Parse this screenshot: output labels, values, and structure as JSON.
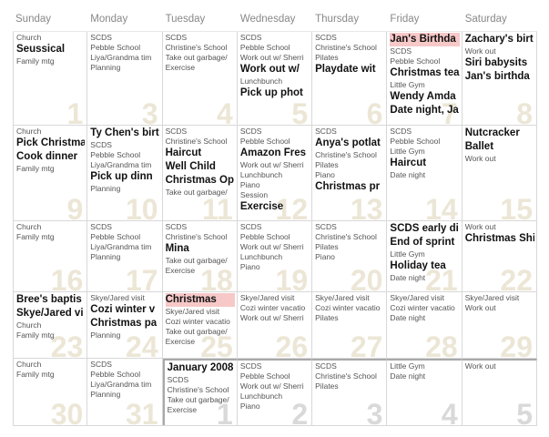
{
  "days_of_week": [
    "Sunday",
    "Monday",
    "Tuesday",
    "Wednesday",
    "Thursday",
    "Friday",
    "Saturday"
  ],
  "weeks": [
    {
      "h": 102,
      "cells": [
        {
          "day": "1",
          "events": [
            {
              "t": "Church",
              "s": "s"
            },
            {
              "t": "Seussical",
              "s": "b"
            },
            {
              "t": "Family mtg",
              "s": "s"
            }
          ]
        },
        {
          "day": "3",
          "events": [
            {
              "t": "SCDS",
              "s": "s"
            },
            {
              "t": "Pebble School",
              "s": "s"
            },
            {
              "t": "Liya/Grandma tim",
              "s": "s"
            },
            {
              "t": "Planning",
              "s": "s"
            }
          ]
        },
        {
          "day": "4",
          "events": [
            {
              "t": "SCDS",
              "s": "s"
            },
            {
              "t": "Christine's School",
              "s": "s"
            },
            {
              "t": "Take out garbage/",
              "s": "s"
            },
            {
              "t": "Exercise",
              "s": "s"
            }
          ]
        },
        {
          "day": "5",
          "events": [
            {
              "t": "SCDS",
              "s": "s"
            },
            {
              "t": "Pebble School",
              "s": "s"
            },
            {
              "t": "Work out w/ Sherri",
              "s": "s"
            },
            {
              "t": "Work out w/",
              "s": "b"
            },
            {
              "t": "Lunchbunch",
              "s": "s"
            },
            {
              "t": "Pick up phot",
              "s": "b"
            }
          ]
        },
        {
          "day": "6",
          "events": [
            {
              "t": "SCDS",
              "s": "s"
            },
            {
              "t": "Christine's School",
              "s": "s"
            },
            {
              "t": "Pilates",
              "s": "s"
            },
            {
              "t": "Playdate wit",
              "s": "b"
            }
          ]
        },
        {
          "day": "7",
          "events": [
            {
              "t": "Jan's Birthda",
              "s": "b",
              "hl": true
            },
            {
              "t": "SCDS",
              "s": "s"
            },
            {
              "t": "Pebble School",
              "s": "s"
            },
            {
              "t": "Christmas tea",
              "s": "b"
            },
            {
              "t": "Little Gym",
              "s": "s"
            },
            {
              "t": "Wendy Amda",
              "s": "b"
            },
            {
              "t": "Date night, Ja",
              "s": "b"
            }
          ]
        },
        {
          "day": "8",
          "events": [
            {
              "t": "Zachary's birt",
              "s": "b"
            },
            {
              "t": "Work out",
              "s": "s"
            },
            {
              "t": "Siri babysits",
              "s": "b"
            },
            {
              "t": "Jan's birthda",
              "s": "b"
            }
          ]
        }
      ]
    },
    {
      "h": 104,
      "cells": [
        {
          "day": "9",
          "events": [
            {
              "t": "Church",
              "s": "s"
            },
            {
              "t": "Pick Christma",
              "s": "b"
            },
            {
              "t": "Cook dinner",
              "s": "b"
            },
            {
              "t": "Family mtg",
              "s": "s"
            }
          ]
        },
        {
          "day": "10",
          "events": [
            {
              "t": "Ty Chen's birt",
              "s": "b"
            },
            {
              "t": "SCDS",
              "s": "s"
            },
            {
              "t": "Pebble School",
              "s": "s"
            },
            {
              "t": "Liya/Grandma tim",
              "s": "s"
            },
            {
              "t": "Pick up dinn",
              "s": "b"
            },
            {
              "t": "Planning",
              "s": "s"
            }
          ]
        },
        {
          "day": "11",
          "events": [
            {
              "t": "SCDS",
              "s": "s"
            },
            {
              "t": "Christine's School",
              "s": "s"
            },
            {
              "t": "Haircut",
              "s": "b"
            },
            {
              "t": "Well Child",
              "s": "b"
            },
            {
              "t": "Christmas Op",
              "s": "b"
            },
            {
              "t": "Take out garbage/",
              "s": "s"
            }
          ]
        },
        {
          "day": "12",
          "events": [
            {
              "t": "SCDS",
              "s": "s"
            },
            {
              "t": "Pebble School",
              "s": "s"
            },
            {
              "t": "Amazon Fres",
              "s": "b"
            },
            {
              "t": "Work out w/ Sherri",
              "s": "s"
            },
            {
              "t": "Lunchbunch",
              "s": "s"
            },
            {
              "t": "Piano",
              "s": "s"
            },
            {
              "t": "Session",
              "s": "s"
            },
            {
              "t": "Exercise",
              "s": "b"
            }
          ]
        },
        {
          "day": "13",
          "events": [
            {
              "t": "SCDS",
              "s": "s"
            },
            {
              "t": "Anya's potlat",
              "s": "b"
            },
            {
              "t": "Christine's School",
              "s": "s"
            },
            {
              "t": "Pilates",
              "s": "s"
            },
            {
              "t": "Piano",
              "s": "s"
            },
            {
              "t": "Christmas pr",
              "s": "b"
            }
          ]
        },
        {
          "day": "14",
          "events": [
            {
              "t": "SCDS",
              "s": "s"
            },
            {
              "t": "Pebble School",
              "s": "s"
            },
            {
              "t": "Little Gym",
              "s": "s"
            },
            {
              "t": "Haircut",
              "s": "b"
            },
            {
              "t": "Date night",
              "s": "s"
            }
          ]
        },
        {
          "day": "15",
          "events": [
            {
              "t": "Nutcracker",
              "s": "b"
            },
            {
              "t": "Ballet",
              "s": "b"
            },
            {
              "t": "Work out",
              "s": "s"
            }
          ]
        }
      ]
    },
    {
      "h": 77,
      "cells": [
        {
          "day": "16",
          "events": [
            {
              "t": "Church",
              "s": "s"
            },
            {
              "t": "Family mtg",
              "s": "s"
            }
          ]
        },
        {
          "day": "17",
          "events": [
            {
              "t": "SCDS",
              "s": "s"
            },
            {
              "t": "Pebble School",
              "s": "s"
            },
            {
              "t": "Liya/Grandma tim",
              "s": "s"
            },
            {
              "t": "Planning",
              "s": "s"
            }
          ]
        },
        {
          "day": "18",
          "events": [
            {
              "t": "SCDS",
              "s": "s"
            },
            {
              "t": "Christine's School",
              "s": "s"
            },
            {
              "t": "Mina",
              "s": "b"
            },
            {
              "t": "Take out garbage/",
              "s": "s"
            },
            {
              "t": "Exercise",
              "s": "s"
            }
          ]
        },
        {
          "day": "19",
          "events": [
            {
              "t": "SCDS",
              "s": "s"
            },
            {
              "t": "Pebble School",
              "s": "s"
            },
            {
              "t": "Work out w/ Sherri",
              "s": "s"
            },
            {
              "t": "Lunchbunch",
              "s": "s"
            },
            {
              "t": "Piano",
              "s": "s"
            }
          ]
        },
        {
          "day": "20",
          "events": [
            {
              "t": "SCDS",
              "s": "s"
            },
            {
              "t": "Christine's School",
              "s": "s"
            },
            {
              "t": "Pilates",
              "s": "s"
            },
            {
              "t": "Piano",
              "s": "s"
            }
          ]
        },
        {
          "day": "21",
          "events": [
            {
              "t": "SCDS early di",
              "s": "b"
            },
            {
              "t": "End of sprint",
              "s": "b"
            },
            {
              "t": "Little Gym",
              "s": "s"
            },
            {
              "t": "Holiday tea",
              "s": "b"
            },
            {
              "t": "Date night",
              "s": "s"
            }
          ]
        },
        {
          "day": "22",
          "events": [
            {
              "t": "Work out",
              "s": "s"
            },
            {
              "t": "Christmas Shi",
              "s": "b"
            }
          ]
        }
      ]
    },
    {
      "h": 72,
      "cells": [
        {
          "day": "23",
          "events": [
            {
              "t": "Bree's baptis",
              "s": "b"
            },
            {
              "t": "Skye/Jared vi",
              "s": "b"
            },
            {
              "t": "Church",
              "s": "s"
            },
            {
              "t": "Family mtg",
              "s": "s"
            }
          ]
        },
        {
          "day": "24",
          "events": [
            {
              "t": "Skye/Jared visit",
              "s": "s"
            },
            {
              "t": "Cozi winter v",
              "s": "b"
            },
            {
              "t": "Christmas pa",
              "s": "b"
            },
            {
              "t": "Planning",
              "s": "s"
            }
          ]
        },
        {
          "day": "25",
          "events": [
            {
              "t": "Christmas",
              "s": "b",
              "hl": true
            },
            {
              "t": "Skye/Jared visit",
              "s": "s"
            },
            {
              "t": "Cozi winter vacatio",
              "s": "s"
            },
            {
              "t": "Take out garbage/",
              "s": "s"
            },
            {
              "t": "Exercise",
              "s": "s"
            }
          ]
        },
        {
          "day": "26",
          "events": [
            {
              "t": "Skye/Jared visit",
              "s": "s"
            },
            {
              "t": "Cozi winter vacatio",
              "s": "s"
            },
            {
              "t": "Work out w/ Sherri",
              "s": "s"
            }
          ]
        },
        {
          "day": "27",
          "events": [
            {
              "t": "Skye/Jared visit",
              "s": "s"
            },
            {
              "t": "Cozi winter vacatio",
              "s": "s"
            },
            {
              "t": "Pilates",
              "s": "s"
            }
          ]
        },
        {
          "day": "28",
          "events": [
            {
              "t": "Skye/Jared visit",
              "s": "s"
            },
            {
              "t": "Cozi winter vacatio",
              "s": "s"
            },
            {
              "t": "Date night",
              "s": "s"
            }
          ]
        },
        {
          "day": "29",
          "events": [
            {
              "t": "Skye/Jared visit",
              "s": "s"
            },
            {
              "t": "Work out",
              "s": "s"
            }
          ]
        }
      ]
    },
    {
      "h": 73,
      "cells": [
        {
          "day": "30",
          "events": [
            {
              "t": "Church",
              "s": "s"
            },
            {
              "t": "Family mtg",
              "s": "s"
            }
          ]
        },
        {
          "day": "31",
          "events": [
            {
              "t": "SCDS",
              "s": "s"
            },
            {
              "t": "Pebble School",
              "s": "s"
            },
            {
              "t": "Liya/Grandma tim",
              "s": "s"
            },
            {
              "t": "Planning",
              "s": "s"
            }
          ]
        },
        {
          "day": "1",
          "next": true,
          "splitTop": true,
          "splitLeft": true,
          "events": [
            {
              "t": "January 2008",
              "s": "b"
            },
            {
              "t": "SCDS",
              "s": "s"
            },
            {
              "t": "Christine's School",
              "s": "s"
            },
            {
              "t": "Take out garbage/",
              "s": "s"
            },
            {
              "t": "Exercise",
              "s": "s"
            }
          ]
        },
        {
          "day": "2",
          "next": true,
          "splitTop": true,
          "events": [
            {
              "t": "SCDS",
              "s": "s"
            },
            {
              "t": "Pebble School",
              "s": "s"
            },
            {
              "t": "Work out w/ Sherri",
              "s": "s"
            },
            {
              "t": "Lunchbunch",
              "s": "s"
            },
            {
              "t": "Piano",
              "s": "s"
            }
          ]
        },
        {
          "day": "3",
          "next": true,
          "splitTop": true,
          "events": [
            {
              "t": "SCDS",
              "s": "s"
            },
            {
              "t": "Christine's School",
              "s": "s"
            },
            {
              "t": "Pilates",
              "s": "s"
            }
          ]
        },
        {
          "day": "4",
          "next": true,
          "splitTop": true,
          "events": [
            {
              "t": "Little Gym",
              "s": "s"
            },
            {
              "t": "Date night",
              "s": "s"
            }
          ]
        },
        {
          "day": "5",
          "next": true,
          "splitTop": true,
          "events": [
            {
              "t": "Work out",
              "s": "s"
            }
          ]
        }
      ]
    }
  ]
}
